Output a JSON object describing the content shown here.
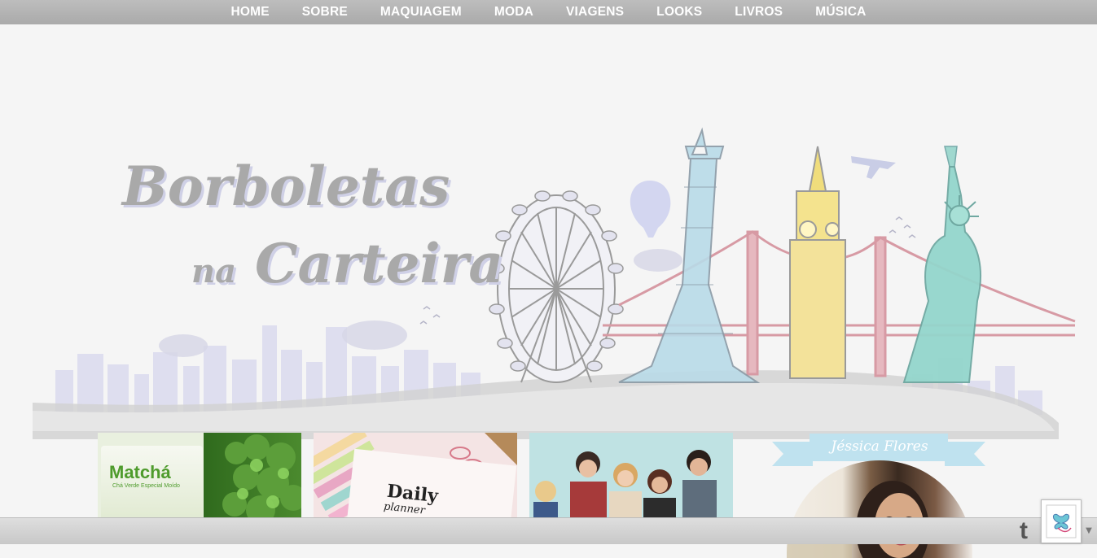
{
  "nav": {
    "items": [
      "HOME",
      "SOBRE",
      "MAQUIAGEM",
      "MODA",
      "VIAGENS",
      "LOOKS",
      "LIVROS",
      "MÚSICA"
    ]
  },
  "header": {
    "logo_line1": "Borboletas",
    "logo_line2_small": "na",
    "logo_line2": "Carteira"
  },
  "posts": [
    {
      "title": "Matchá",
      "subtitle": "Chá Verde Especial Moído"
    },
    {
      "title": "Daily",
      "subtitle": "planner"
    },
    {
      "title": ""
    }
  ],
  "sidebar": {
    "author_name": "Jéssica Flores"
  },
  "colors": {
    "nav_bg": "#b3b3b3",
    "logo": "#a9a9a9",
    "ribbon": "#bfe2ef",
    "page_bg": "#f5f5f5"
  },
  "icons": [
    "twitter-icon",
    "butterfly-badge-icon",
    "scroll-down-icon"
  ]
}
